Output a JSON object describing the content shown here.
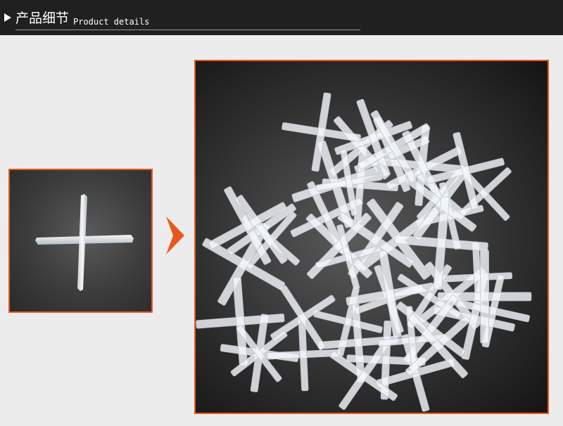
{
  "header": {
    "title": "产品细节",
    "subtitle": "Product details",
    "icon": "play-arrow-icon"
  },
  "accent_color": "#e8581c",
  "images": {
    "single_spacer": "tile-cross-spacer-single",
    "spacer_pile": "tile-cross-spacer-pile"
  },
  "decor": {
    "arrow_icon": "chevron-right-icon"
  }
}
